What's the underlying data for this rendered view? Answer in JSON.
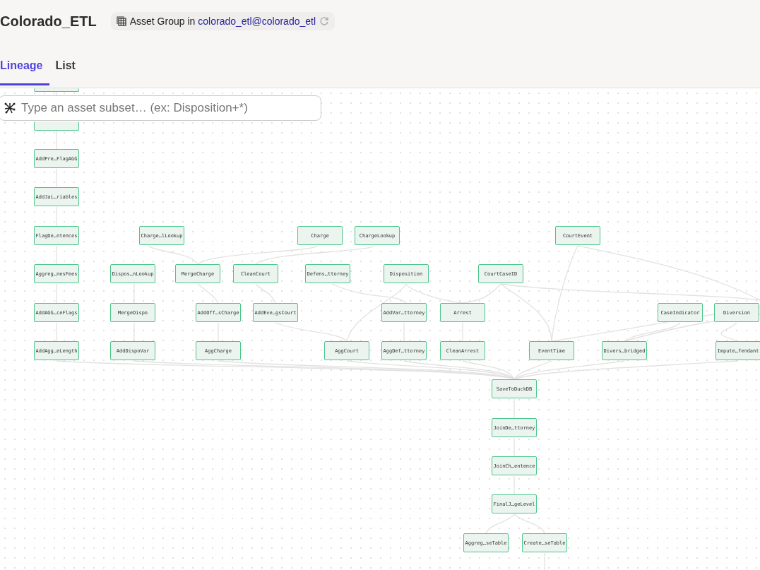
{
  "header": {
    "title": "Colorado_ETL",
    "badge": {
      "prefix": "Asset Group in",
      "link": "colorado_etl@colorado_etl"
    }
  },
  "tabs": [
    {
      "label": "Lineage",
      "selected": true
    },
    {
      "label": "List",
      "selected": false
    }
  ],
  "search": {
    "placeholder": "Type an asset subset… (ex: Disposition+*)"
  },
  "graph": {
    "nodes": [
      {
        "label": "AddPre…FlagAGG"
      },
      {
        "label": "AddJai…riables"
      },
      {
        "label": "FlagDe…ntences"
      },
      {
        "label": "Charge…lLookup"
      },
      {
        "label": "Charge"
      },
      {
        "label": "ChargeLookup"
      },
      {
        "label": "CourtEvent"
      },
      {
        "label": "Aggreg…nesFees"
      },
      {
        "label": "Dispos…nLookup"
      },
      {
        "label": "MergeCharge"
      },
      {
        "label": "CleanCourt"
      },
      {
        "label": "Defens…ttorney"
      },
      {
        "label": "Disposition"
      },
      {
        "label": "CourtCaseID"
      },
      {
        "label": "AddAGG…ceFlags"
      },
      {
        "label": "MergeDispo"
      },
      {
        "label": "AddOff…sCharge"
      },
      {
        "label": "AddEve…gsCourt"
      },
      {
        "label": "AddVar…ttorney"
      },
      {
        "label": "Arrest"
      },
      {
        "label": "CaseIndicator"
      },
      {
        "label": "Diversion"
      },
      {
        "label": "AddAgg…eLength"
      },
      {
        "label": "AddDispoVar"
      },
      {
        "label": "AggCharge"
      },
      {
        "label": "AggCourt"
      },
      {
        "label": "AggDef…ttorney"
      },
      {
        "label": "CleanArrest"
      },
      {
        "label": "EventTime"
      },
      {
        "label": "Divers…bridged"
      },
      {
        "label": "Impute…fendant"
      },
      {
        "label": "SaveToDuckDB"
      },
      {
        "label": "JoinDe…ttorney"
      },
      {
        "label": "JoinCh…entence"
      },
      {
        "label": "FinalJ…geLevel"
      },
      {
        "label": "Aggreg…seTable"
      },
      {
        "label": "Create…seTable"
      }
    ]
  }
}
